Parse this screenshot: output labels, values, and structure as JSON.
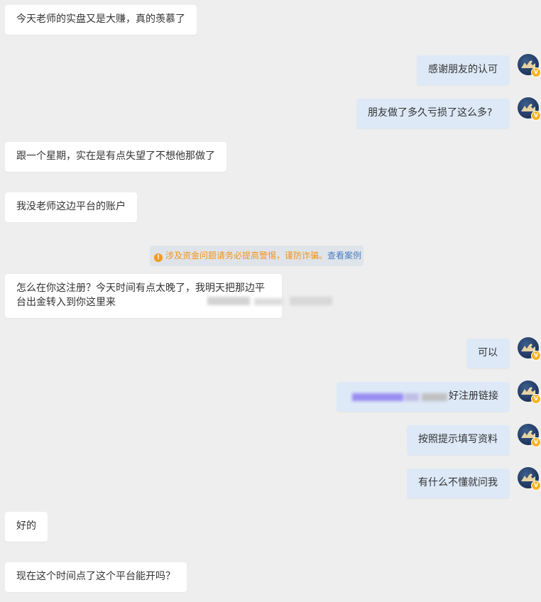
{
  "messages": [
    {
      "side": "left",
      "text": "今天老师的实盘又是大赚，真的羡慕了"
    },
    {
      "side": "right",
      "text": "感谢朋友的认可"
    },
    {
      "side": "right",
      "text": "朋友做了多久亏损了这么多?"
    },
    {
      "side": "left",
      "text": "跟一个星期，实在是有点失望了不想他那做了"
    },
    {
      "side": "left",
      "text": "我没老师这边平台的账户"
    },
    {
      "side": "left",
      "text": "怎么在你这注册？今天时间有点太晚了，我明天把那边平台出金转入到你这里来"
    },
    {
      "side": "right",
      "text": "可以"
    },
    {
      "side": "right",
      "text": "好注册链接"
    },
    {
      "side": "right",
      "text": "按照提示填写资料"
    },
    {
      "side": "right",
      "text": "有什么不懂就问我"
    },
    {
      "side": "left",
      "text": "好的"
    },
    {
      "side": "left",
      "text": "现在这个时间点了这个平台能开吗？"
    }
  ],
  "notice": {
    "icon": "warning-icon",
    "icon_glyph": "!",
    "text": "涉及资金问题请务必提高警惕，谨防诈骗。",
    "link": "查看案例"
  },
  "avatar": {
    "badge": "V"
  },
  "colors": {
    "background": "#eeeeee",
    "left_bubble": "#ffffff",
    "right_bubble": "#dde9f7",
    "warning": "#f0941a",
    "link": "#4a7dc2"
  }
}
